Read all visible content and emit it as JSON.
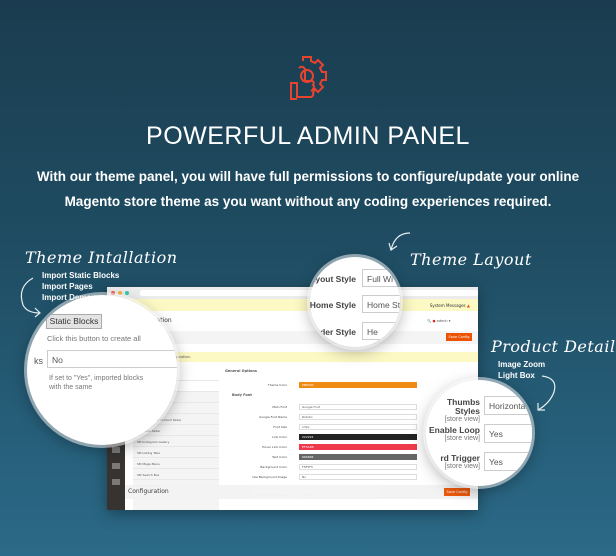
{
  "header": {
    "icon": "gear-thumbs-up-icon",
    "icon_color": "#e8432e",
    "title": "POWERFUL ADMIN PANEL",
    "description": "With our theme panel, you will have full permissions to configure/update your online Magento store theme as you want without any coding experiences required."
  },
  "callouts": {
    "install": {
      "title": "Theme Intallation",
      "items": [
        "Import Static Blocks",
        "Import Pages",
        "Import Demos"
      ]
    },
    "layout": {
      "title": "Theme Layout"
    },
    "product": {
      "title": "Product Detail",
      "items": [
        "Image Zoom",
        "Light Box"
      ]
    }
  },
  "zoom_install": {
    "button": "Static Blocks",
    "hint": "Click this button to create all",
    "label_tail": "ks",
    "value": "No",
    "note": "If set to \"Yes\", imported blocks with the same"
  },
  "zoom_layout": {
    "rows": [
      {
        "label": "Layout Style",
        "value": "Full Wi"
      },
      {
        "label": "Home Style",
        "value": "Home St"
      },
      {
        "label": "der Style",
        "value": "He"
      }
    ]
  },
  "zoom_product": {
    "store_view": "[store view]",
    "rows": [
      {
        "label": "Thumbs Styles",
        "value": "Horizontal"
      },
      {
        "label": "Enable Loop",
        "value": "Yes"
      },
      {
        "label": "rd Trigger",
        "value": "Yes"
      }
    ]
  },
  "admin": {
    "system_messages": "System Messages",
    "user": "admin",
    "page_title": "Configuration",
    "scope_label": "Store View:",
    "scope_value": "Default Config",
    "save": "Save Config",
    "saved_msg": "You saved the configuration.",
    "tree_header": "MAGENTECH.COM",
    "tree_items": [
      "SM Topdeals",
      "SM Listing Deals",
      "SM Basic Products",
      "SM Countdown Product Slider",
      "SM Deals Slider",
      "SM Instagram Gallery",
      "SM Listing Tabs",
      "SM Mega Menu",
      "SM Search Box",
      "SM Cart Quick Pro"
    ],
    "section": "General Options",
    "subsection": "Body Font",
    "fields": [
      {
        "label": "Theme Color",
        "value": "EB8300",
        "color": "#ef8a12"
      },
      {
        "label": "Main Font",
        "value": "Google Font"
      },
      {
        "label": "Google Font Name",
        "value": "Roboto"
      },
      {
        "label": "Font Size",
        "value": "13px"
      },
      {
        "label": "Link Color",
        "value": "222222",
        "color": "#222222"
      },
      {
        "label": "Hover Link Color",
        "value": "EF3A4B",
        "color": "#ef3a4b"
      },
      {
        "label": "Text Color",
        "value": "666666",
        "color": "#666666"
      },
      {
        "label": "Background Color",
        "value": "F5F5F5"
      },
      {
        "label": "Use Background Image",
        "value": "No"
      },
      {
        "label": "Google Font Target",
        "value": "Selector"
      }
    ],
    "sticky_title": "Configuration"
  }
}
